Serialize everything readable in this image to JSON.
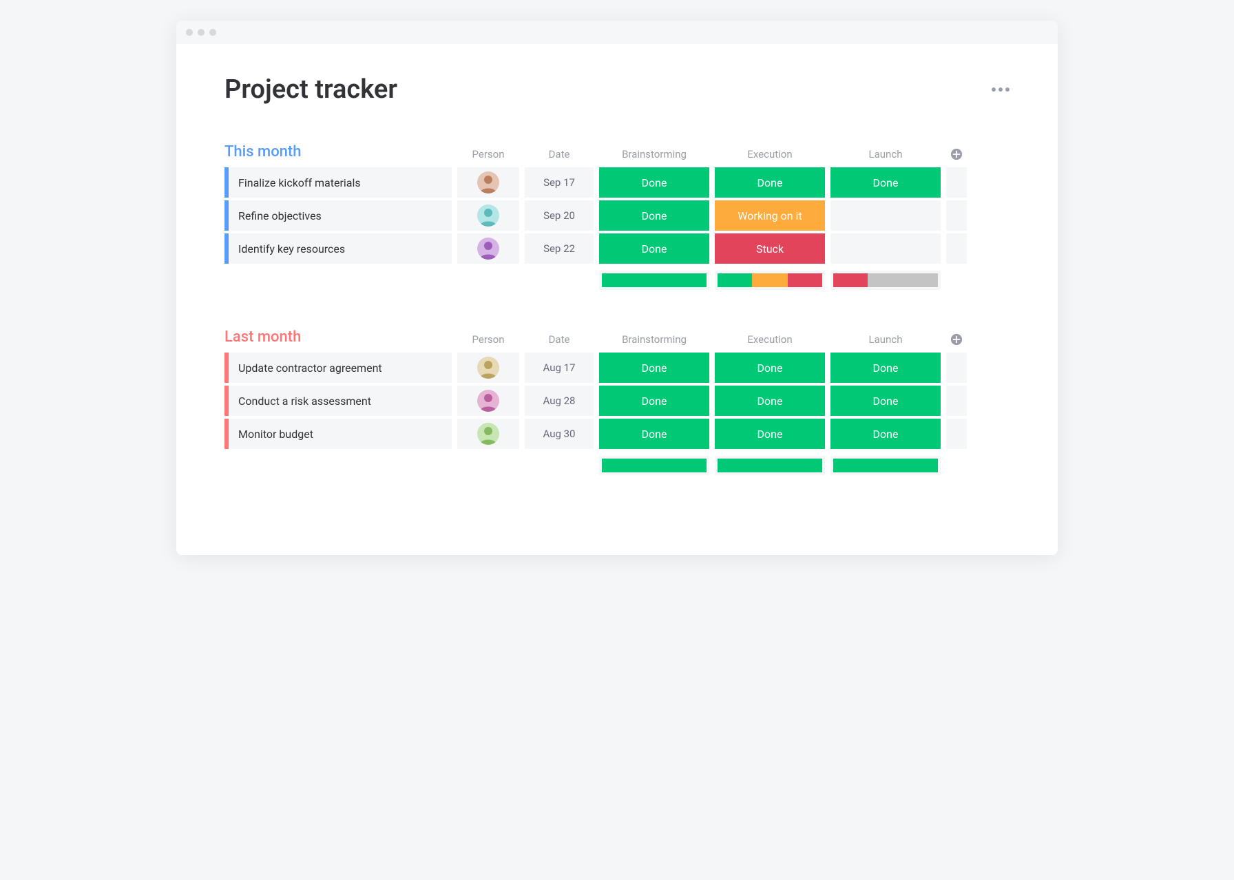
{
  "page": {
    "title": "Project tracker"
  },
  "columns": {
    "person": "Person",
    "date": "Date",
    "brainstorming": "Brainstorming",
    "execution": "Execution",
    "launch": "Launch"
  },
  "statuses": {
    "done": "Done",
    "working": "Working on it",
    "stuck": "Stuck"
  },
  "groups": [
    {
      "id": "this-month",
      "title": "This month",
      "color": "blue",
      "rows": [
        {
          "task": "Finalize kickoff materials",
          "date": "Sep 17",
          "brainstorming": "done",
          "execution": "done",
          "launch": "done"
        },
        {
          "task": "Refine objectives",
          "date": "Sep 20",
          "brainstorming": "done",
          "execution": "working",
          "launch": "empty"
        },
        {
          "task": "Identify key resources",
          "date": "Sep 22",
          "brainstorming": "done",
          "execution": "stuck",
          "launch": "empty"
        }
      ],
      "summary": {
        "brainstorming": [
          {
            "status": "done",
            "pct": 100
          }
        ],
        "execution": [
          {
            "status": "done",
            "pct": 33
          },
          {
            "status": "working",
            "pct": 34
          },
          {
            "status": "stuck",
            "pct": 33
          }
        ],
        "launch": [
          {
            "status": "stuck",
            "pct": 33
          },
          {
            "status": "empty",
            "pct": 67
          }
        ]
      }
    },
    {
      "id": "last-month",
      "title": "Last month",
      "color": "red",
      "rows": [
        {
          "task": "Update contractor agreement",
          "date": "Aug 17",
          "brainstorming": "done",
          "execution": "done",
          "launch": "done"
        },
        {
          "task": "Conduct a risk assessment",
          "date": "Aug 28",
          "brainstorming": "done",
          "execution": "done",
          "launch": "done"
        },
        {
          "task": "Monitor budget",
          "date": "Aug 30",
          "brainstorming": "done",
          "execution": "done",
          "launch": "done"
        }
      ],
      "summary": {
        "brainstorming": [
          {
            "status": "done",
            "pct": 100
          }
        ],
        "execution": [
          {
            "status": "done",
            "pct": 100
          }
        ],
        "launch": [
          {
            "status": "done",
            "pct": 100
          }
        ]
      }
    }
  ]
}
